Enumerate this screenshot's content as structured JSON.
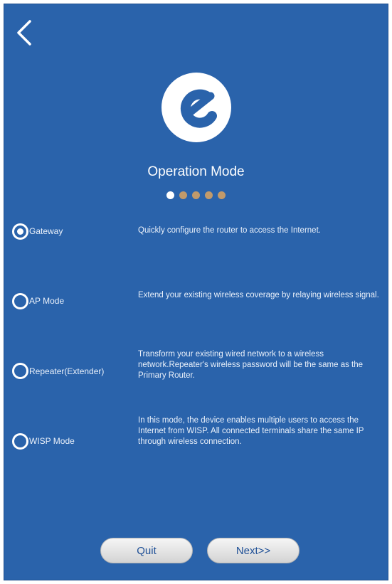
{
  "header": {
    "back_icon": "chevron-left-icon",
    "logo_icon": "brand-logo-icon"
  },
  "page": {
    "title": "Operation Mode",
    "step_total": 5,
    "step_current": 1
  },
  "modes": [
    {
      "label": "Gateway",
      "description": "Quickly configure the router to access the Internet.",
      "selected": true
    },
    {
      "label": "AP Mode",
      "description": "Extend your existing wireless coverage by relaying wireless signal.",
      "selected": false
    },
    {
      "label": "Repeater(Extender)",
      "description": "Transform your existing wired network to a wireless network.Repeater's wireless password will be the same as the Primary Router.",
      "selected": false
    },
    {
      "label": "WISP Mode",
      "description": "In this mode, the device enables multiple users to access the Internet from WISP. All connected terminals share the same IP through wireless connection.",
      "selected": false
    }
  ],
  "buttons": {
    "quit": "Quit",
    "next": "Next>>"
  },
  "colors": {
    "background": "#2a63ab",
    "dot_active": "#ffffff",
    "dot_inactive": "#c19a6b",
    "button_text": "#1e4f96"
  }
}
